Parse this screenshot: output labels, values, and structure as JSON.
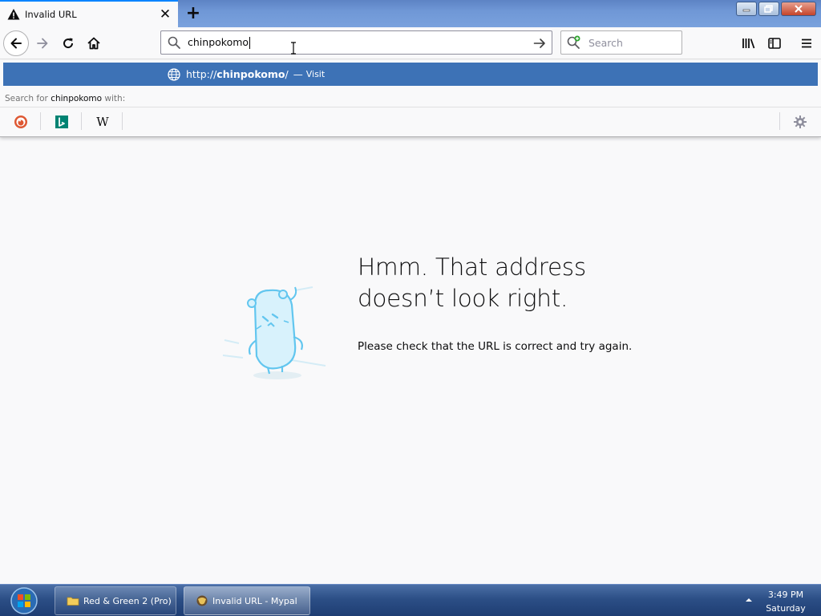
{
  "tab": {
    "title": "Invalid URL",
    "close_glyph": "✕",
    "icon": "warning-icon"
  },
  "newtab": {
    "glyph": "+"
  },
  "urlbar": {
    "value": "chinpokomo"
  },
  "searchbar": {
    "placeholder": "Search"
  },
  "suggestion": {
    "prefix": "http://",
    "domain": "chinpokomo",
    "suffix": "/",
    "separator": "—",
    "action": "Visit"
  },
  "search_with": {
    "before": "Search for",
    "term": "chinpokomo",
    "after": "with:"
  },
  "engines": [
    {
      "name": "DuckDuckGo",
      "icon": "duckduckgo-icon"
    },
    {
      "name": "Bing",
      "icon": "bing-icon"
    },
    {
      "name": "Wikipedia",
      "icon": "wikipedia-icon",
      "glyph": "W"
    }
  ],
  "error": {
    "title_line1": "Hmm. That address",
    "title_line2": "doesn’t look right.",
    "description": "Please check that the URL is correct and try again."
  },
  "taskbar": {
    "items": [
      {
        "label": "Red & Green 2 (Pro)",
        "icon": "folder-icon"
      },
      {
        "label": "Invalid URL - Mypal",
        "icon": "mypal-icon"
      }
    ],
    "clock": {
      "time": "3:49 PM",
      "day": "Saturday"
    }
  },
  "colors": {
    "accent": "#0a84ff",
    "suggest_highlight": "#3d72b6",
    "page_bg": "#f9f9fa",
    "taskbar": "#2c4f86"
  }
}
